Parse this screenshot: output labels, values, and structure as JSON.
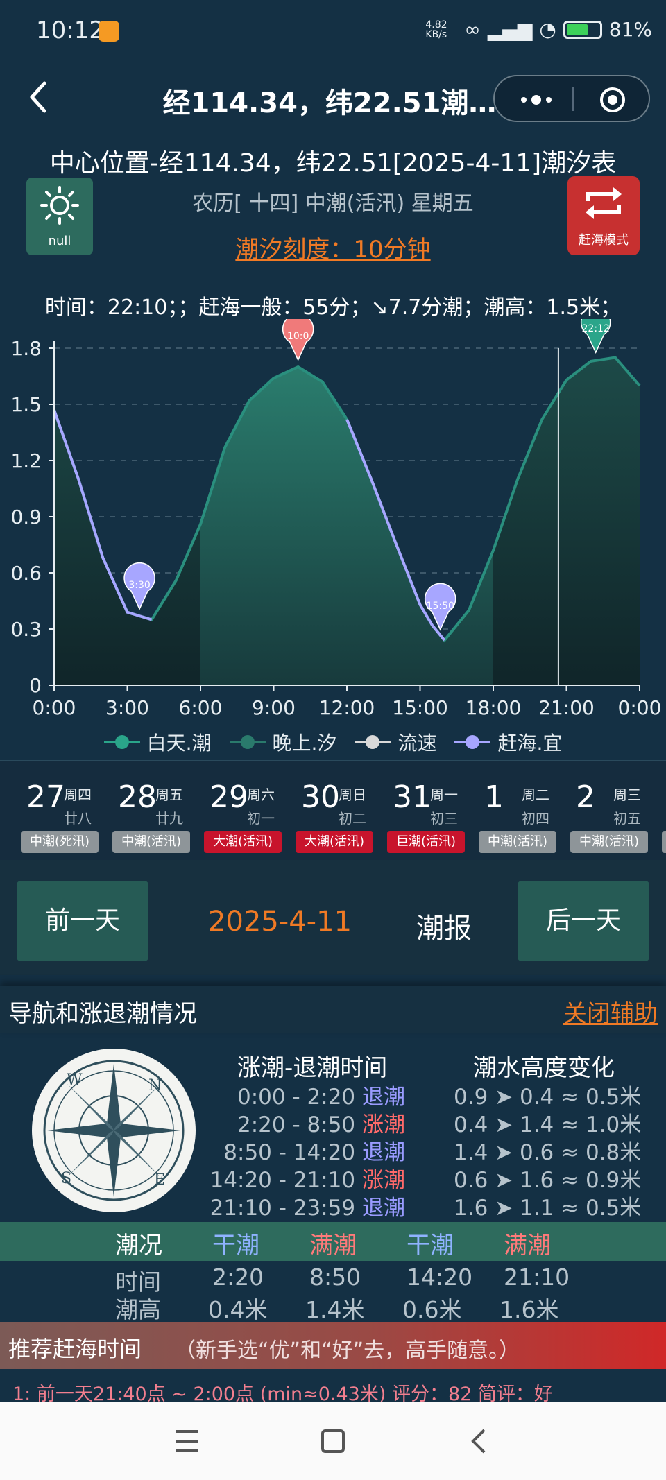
{
  "status_bar": {
    "time": "10:12",
    "net_speed": "4.82 KB/s",
    "battery": "81%",
    "battery_level": 0.81
  },
  "header": {
    "title": "经114.34，纬22.51潮…"
  },
  "info": {
    "center_title": "中心位置-经114.34，纬22.51[2025-4-11]潮汐表",
    "lunar_line": "农历[ 十四] 中潮(活汛) 星期五",
    "scale_link": "潮汐刻度：10分钟",
    "weather_label": "null",
    "mode_label": "赶海模式",
    "cursor_info": "时间：22:10；；赶海一般：55分；↘7.7分潮；潮高：1.5米；"
  },
  "chart_data": {
    "type": "area",
    "x_ticks": [
      "0:00",
      "3:00",
      "6:00",
      "9:00",
      "12:00",
      "15:00",
      "18:00",
      "21:00",
      "0:00"
    ],
    "y_ticks": [
      "0",
      "0.3",
      "0.6",
      "0.9",
      "1.2",
      "1.5",
      "1.8"
    ],
    "ylim": [
      0,
      1.8
    ],
    "xlim_hours": [
      0,
      24
    ],
    "cursor_hour": 20.67,
    "day_range_hours": [
      6,
      18
    ],
    "series_points": [
      [
        0,
        1.47
      ],
      [
        1,
        1.1
      ],
      [
        2,
        0.68
      ],
      [
        3,
        0.39
      ],
      [
        3.5,
        0.37
      ],
      [
        4,
        0.35
      ],
      [
        5,
        0.56
      ],
      [
        6,
        0.86
      ],
      [
        7,
        1.27
      ],
      [
        8,
        1.52
      ],
      [
        9,
        1.64
      ],
      [
        10,
        1.7
      ],
      [
        11,
        1.62
      ],
      [
        12,
        1.42
      ],
      [
        13,
        1.1
      ],
      [
        14,
        0.76
      ],
      [
        15,
        0.43
      ],
      [
        15.5,
        0.32
      ],
      [
        16,
        0.24
      ],
      [
        17,
        0.4
      ],
      [
        18,
        0.72
      ],
      [
        19,
        1.1
      ],
      [
        20,
        1.42
      ],
      [
        21,
        1.63
      ],
      [
        22,
        1.73
      ],
      [
        23,
        1.75
      ],
      [
        24,
        1.6
      ]
    ],
    "markers": [
      {
        "label": "3:30",
        "hour": 3.5,
        "value": 0.37,
        "kind": "low"
      },
      {
        "label": "10:0",
        "hour": 10,
        "value": 1.7,
        "kind": "high"
      },
      {
        "label": "15:50",
        "hour": 15.83,
        "value": 0.26,
        "kind": "low"
      },
      {
        "label": "22:12",
        "hour": 22.2,
        "value": 1.74,
        "kind": "cursor"
      }
    ],
    "legend": [
      {
        "name": "白天.潮",
        "color": "#2aa58a"
      },
      {
        "name": "晚上.汐",
        "color": "#2a7a6c"
      },
      {
        "name": "流速",
        "color": "#d9d9d9"
      },
      {
        "name": "赶海.宜",
        "color": "#a7a6ff"
      }
    ]
  },
  "date_strip": [
    {
      "day": "27",
      "week": "周四",
      "lunar": "廿八",
      "tag": "中潮(死汛)",
      "tag_color": "#8e9599"
    },
    {
      "day": "28",
      "week": "周五",
      "lunar": "廿九",
      "tag": "中潮(活汛)",
      "tag_color": "#8e9599"
    },
    {
      "day": "29",
      "week": "周六",
      "lunar": "初一",
      "tag": "大潮(活汛)",
      "tag_color": "#c8142c"
    },
    {
      "day": "30",
      "week": "周日",
      "lunar": "初二",
      "tag": "大潮(活汛)",
      "tag_color": "#c8142c"
    },
    {
      "day": "31",
      "week": "周一",
      "lunar": "初三",
      "tag": "巨潮(活汛)",
      "tag_color": "#c8142c"
    },
    {
      "day": "1",
      "week": "周二",
      "lunar": "初四",
      "tag": "中潮(活汛)",
      "tag_color": "#8e9599"
    },
    {
      "day": "2",
      "week": "周三",
      "lunar": "初五",
      "tag": "中潮(活汛)",
      "tag_color": "#8e9599"
    }
  ],
  "day_nav": {
    "prev": "前一天",
    "date": "2025-4-11",
    "report": "潮报",
    "next": "后一天"
  },
  "nav_section": {
    "title": "导航和涨退潮情况",
    "close": "关闭辅助"
  },
  "tide_table": {
    "head_time": "涨潮-退潮时间",
    "head_height": "潮水高度变化",
    "rows": [
      {
        "time": "0:00 - 2:20",
        "state": "退潮",
        "kind": "blue",
        "height": "0.9 ➤ 0.4 ≈ 0.5米"
      },
      {
        "time": "2:20 - 8:50",
        "state": "涨潮",
        "kind": "red",
        "height": "0.4 ➤ 1.4 ≈ 1.0米"
      },
      {
        "time": "8:50 - 14:20",
        "state": "退潮",
        "kind": "blue",
        "height": "1.4 ➤ 0.6 ≈ 0.8米"
      },
      {
        "time": "14:20 - 21:10",
        "state": "涨潮",
        "kind": "red",
        "height": "0.6 ➤ 1.6 ≈ 0.9米"
      },
      {
        "time": "21:10 - 23:59",
        "state": "退潮",
        "kind": "blue",
        "height": "1.6 ➤ 1.1 ≈ 0.5米"
      }
    ]
  },
  "tide_status": {
    "label": "潮况",
    "cols": [
      {
        "name": "干潮",
        "time": "2:20",
        "height": "0.4米",
        "kind": "blue"
      },
      {
        "name": "满潮",
        "time": "8:50",
        "height": "1.4米",
        "kind": "red"
      },
      {
        "name": "干潮",
        "time": "14:20",
        "height": "0.6米",
        "kind": "blue"
      },
      {
        "name": "满潮",
        "time": "21:10",
        "height": "1.6米",
        "kind": "red"
      }
    ],
    "time_label": "时间",
    "height_label": "潮高"
  },
  "recommend": {
    "title": "推荐赶海时间",
    "note": "（新手选“优”和“好”去，高手随意。）",
    "line": "1:     前一天21:40点 ~ 2:00点 (min≈0.43米)      评分：82    简评：好"
  }
}
